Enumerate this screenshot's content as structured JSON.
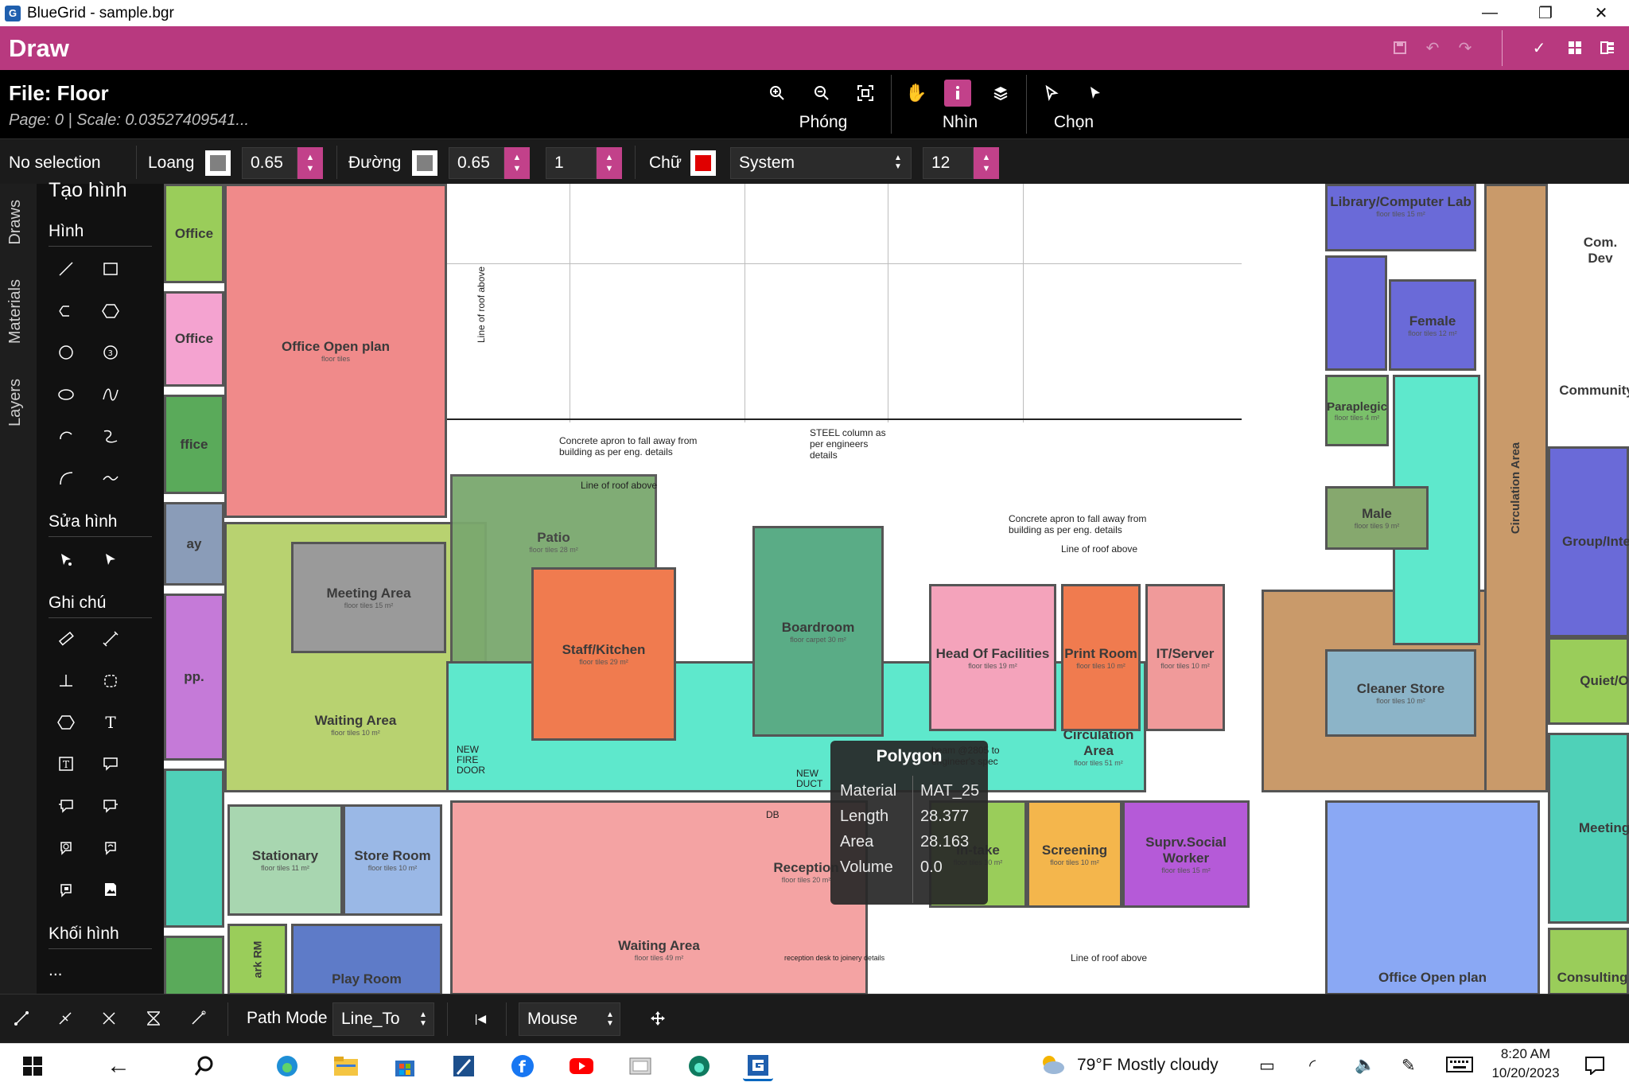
{
  "window": {
    "title": "BlueGrid - sample.bgr",
    "minimize": "—",
    "maximize": "❐",
    "close": "✕"
  },
  "header": {
    "mode_title": "Draw",
    "icons": [
      "save-icon",
      "undo-icon",
      "redo-icon",
      "check-icon",
      "grid-icon",
      "export-icon"
    ]
  },
  "file": {
    "name": "File: Floor",
    "page_scale": "Page: 0 | Scale: 0.03527409541..."
  },
  "toolbar": {
    "zoom_label": "Phóng",
    "view_label": "Nhìn",
    "select_label": "Chọn"
  },
  "props": {
    "selection": "No selection",
    "fill_label": "Loang",
    "fill_color": "#808080",
    "fill_value": "0.65",
    "stroke_label": "Đường",
    "stroke_color": "#808080",
    "stroke_value": "0.65",
    "stroke_width": "1",
    "text_label": "Chữ",
    "text_color": "#e00000",
    "font": "System",
    "font_size": "12"
  },
  "side_tabs": [
    "Draws",
    "Materials",
    "Layers"
  ],
  "panel": {
    "header": "Tạo hình",
    "section_shapes": "Hình",
    "section_edit": "Sửa hình",
    "section_notes": "Ghi chú",
    "section_blocks": "Khối hình",
    "more": "..."
  },
  "floorplan": {
    "rooms": [
      {
        "name": "Office Open plan",
        "sub": "floor tiles"
      },
      {
        "name": "Office",
        "sub": ""
      },
      {
        "name": "Office",
        "sub": ""
      },
      {
        "name": "ffice",
        "sub": ""
      },
      {
        "name": "ay",
        "sub": ""
      },
      {
        "name": "pp.",
        "sub": ""
      },
      {
        "name": "Meeting Area",
        "sub": "floor tiles 15 m²"
      },
      {
        "name": "Waiting Area",
        "sub": "floor tiles 10 m²"
      },
      {
        "name": "Patio",
        "sub": "floor tiles 28 m²"
      },
      {
        "name": "Staff/Kitchen",
        "sub": "floor tiles 29 m²"
      },
      {
        "name": "Boardroom",
        "sub": "floor carpet 30 m²"
      },
      {
        "name": "Head Of Facilities",
        "sub": "floor tiles 19 m²"
      },
      {
        "name": "Print Room",
        "sub": "floor tiles 10 m²"
      },
      {
        "name": "IT/Server",
        "sub": "floor tiles 10 m²"
      },
      {
        "name": "Library/Computer Lab",
        "sub": "floor tiles 15 m²"
      },
      {
        "name": "Female",
        "sub": "floor tiles 12 m²"
      },
      {
        "name": "Paraplegic",
        "sub": "floor tiles 4 m²"
      },
      {
        "name": "Male",
        "sub": "floor tiles 9 m²"
      },
      {
        "name": "Cleaner Store",
        "sub": "floor tiles 10 m²"
      },
      {
        "name": "Circulation Area",
        "sub": "floor tiles 51 m²"
      },
      {
        "name": "Circulation Area",
        "sub": ""
      },
      {
        "name": "Stationary",
        "sub": "floor tiles 11 m²"
      },
      {
        "name": "Store Room",
        "sub": "floor tiles 10 m²"
      },
      {
        "name": "Reception",
        "sub": "floor tiles 20 m²"
      },
      {
        "name": "Waiting Area",
        "sub": "floor tiles 49 m²"
      },
      {
        "name": "In-take",
        "sub": "floor tiles 10 m²"
      },
      {
        "name": "Screening",
        "sub": "floor tiles 10 m²"
      },
      {
        "name": "Suprv.Social Worker",
        "sub": "floor tiles 15 m²"
      },
      {
        "name": "Com. Dev",
        "sub": ""
      },
      {
        "name": "Community",
        "sub": ""
      },
      {
        "name": "Group/Inte",
        "sub": ""
      },
      {
        "name": "Quiet/O",
        "sub": ""
      },
      {
        "name": "Meeting",
        "sub": ""
      },
      {
        "name": "Consulting",
        "sub": ""
      },
      {
        "name": "Office Open plan",
        "sub": ""
      },
      {
        "name": "Play Room",
        "sub": ""
      },
      {
        "name": "ark RM",
        "sub": ""
      }
    ],
    "notes": [
      "Concrete apron to fall away from building as per eng. details",
      "STEEL column as per engineers details",
      "Concrete apron to fall away from building as per eng. details",
      "Line of roof above",
      "Line of roof above",
      "NEW FIRE DOOR",
      "NEW DUCT",
      "DB",
      "beam @2805 to engineer's spec",
      "Line of roof above",
      "Line of roof above",
      "reception desk to joinery details"
    ]
  },
  "tooltip": {
    "title": "Polygon",
    "rows": [
      {
        "key": "Material",
        "value": "MAT_25"
      },
      {
        "key": "Length",
        "value": "28.377"
      },
      {
        "key": "Area",
        "value": "28.163"
      },
      {
        "key": "Volume",
        "value": "0.0"
      }
    ]
  },
  "bottom": {
    "path_mode_label": "Path Mode",
    "path_mode_value": "Line_To",
    "input_value": "Mouse"
  },
  "taskbar": {
    "weather": "79°F  Mostly cloudy",
    "time": "8:20 AM",
    "date": "10/20/2023"
  },
  "colors": {
    "accent": "#b8397f",
    "room_red": "#f08080",
    "room_green": "#5a9a5a",
    "room_orange": "#f07b4f",
    "room_cyan": "#5ee8cc",
    "room_blue": "#6a6ad8"
  }
}
